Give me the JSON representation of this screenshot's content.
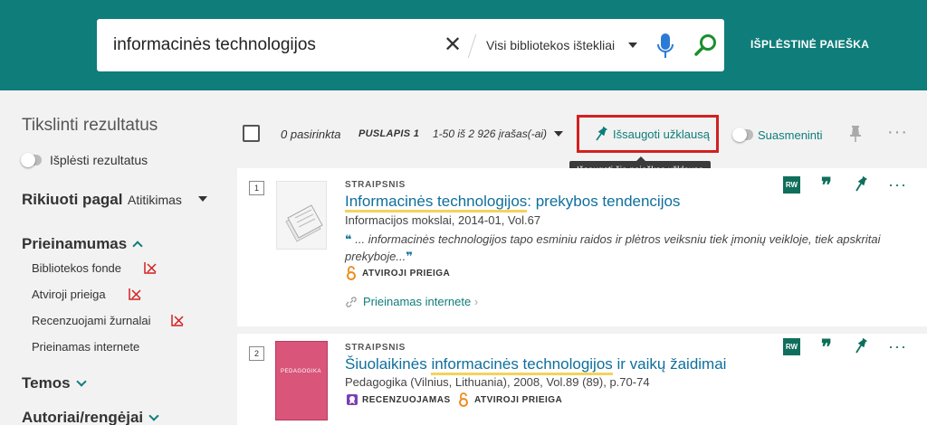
{
  "search": {
    "query": "informacinės technologijos",
    "scope": "Visi bibliotekos ištekliai",
    "clear_glyph": "✕",
    "advanced_label": "IŠPLĖSTINĖ PAIEŠKA"
  },
  "sidebar": {
    "title": "Tikslinti rezultatus",
    "expand_label": "Išplėsti rezultatus",
    "sort_label": "Rikiuoti pagal",
    "sort_value": "Atitikimas",
    "availability_label": "Prieinamumas",
    "facets": [
      "Bibliotekos fonde",
      "Atviroji prieiga",
      "Recenzuojami žurnalai",
      "Prieinamas internete"
    ],
    "topics_label": "Temos",
    "authors_label": "Autoriai/rengėjai"
  },
  "toolbar": {
    "selected": "0 pasirinkta",
    "page": "PUSLAPIS 1",
    "range": "1-50 iš 2 926 įrašas(-ai)",
    "save_query": "Išsaugoti užklausą",
    "tooltip": "Išsaugoti šią paieškos užklausą",
    "personalize": "Suasmeninti",
    "more_glyph": "···"
  },
  "results": [
    {
      "number": "1",
      "type": "STRAIPSNIS",
      "title_hl": "Informacinės technologijos",
      "title_rest": ": prekybos tendencijos",
      "meta": "Informacijos mokslai, 2014-01, Vol.67",
      "snippet": "... informacinės technologijos tapo esminiu raidos ir plėtros veiksniu tiek įmonių veikloje, tiek apskritai prekyboje...",
      "open_access": "ATVIROJI PRIEIGA",
      "online": "Prieinamas internete"
    },
    {
      "number": "2",
      "type": "STRAIPSNIS",
      "title_pre": "Šiuolaikinės ",
      "title_hl": "informacinės technologijos",
      "title_rest": " ir vaikų žaidimai",
      "meta": "Pedagogika (Vilnius, Lithuania), 2008, Vol.89 (89), p.70-74",
      "peer_reviewed": "RECENZUOJAMAS",
      "open_access": "ATVIROJI PRIEIGA",
      "cover_text": "PEDAGOGIKA"
    }
  ],
  "actions": {
    "rw": "RW",
    "cite_glyph": "❞",
    "more_glyph": "···",
    "quote_open": "❝",
    "quote_close": "❞"
  },
  "colors": {
    "header": "#0f7d7a",
    "link": "#0f6f9c",
    "highlight": "#f4d35e",
    "save_border": "#d32020"
  }
}
